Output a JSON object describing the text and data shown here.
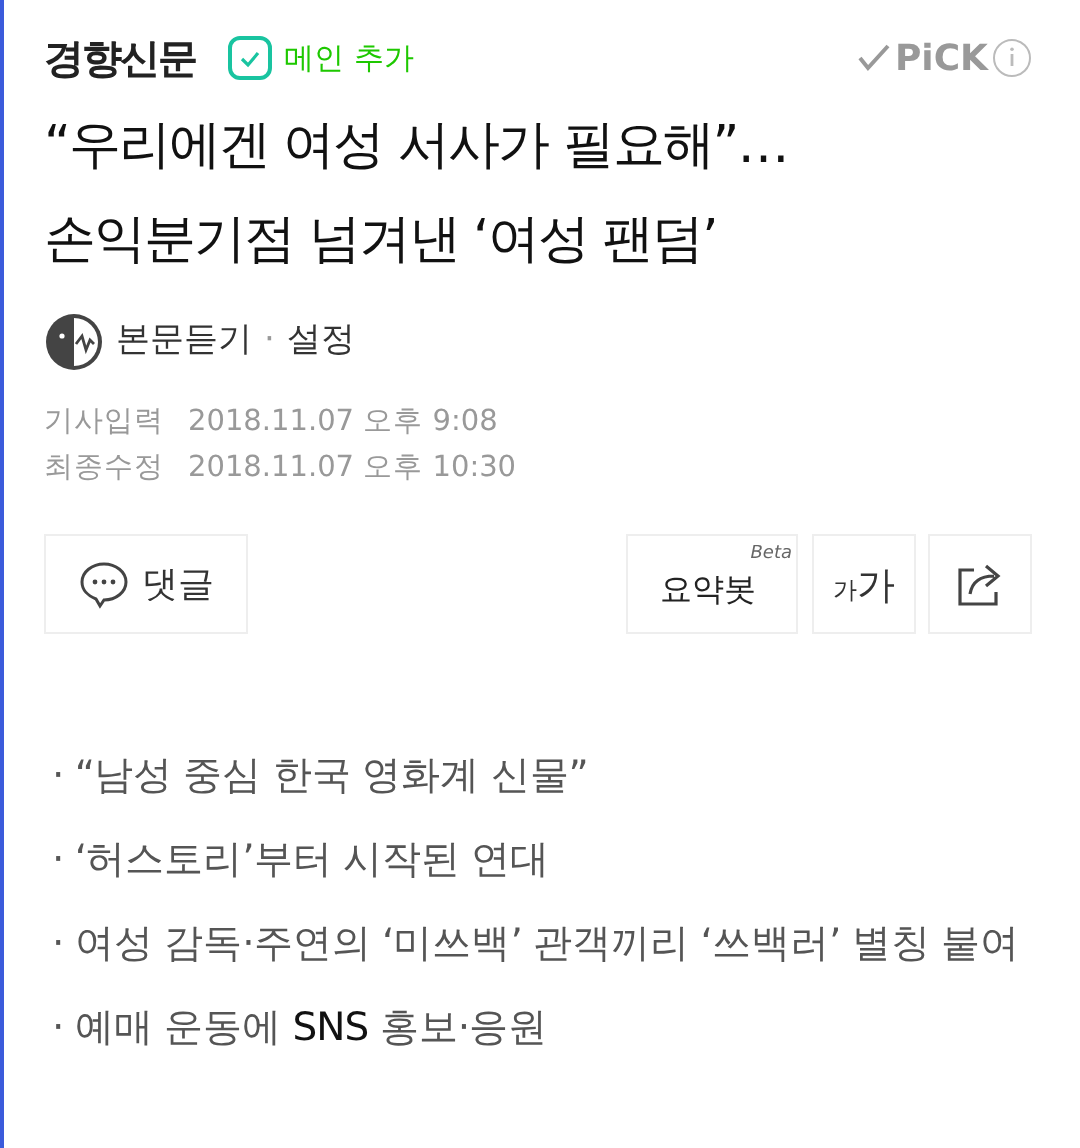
{
  "header": {
    "press": "경향신문",
    "follow_label": "메인 추가",
    "pick_label": "PiCK"
  },
  "headline": [
    "“우리에겐 여성 서사가 필요해”…",
    "손익분기점 넘겨낸 ‘여성 팬덤’"
  ],
  "listen": {
    "label": "본문듣기",
    "separator": "·",
    "settings": "설정"
  },
  "dates": [
    {
      "label": "기사입력",
      "value": "2018.11.07 오후 9:08"
    },
    {
      "label": "최종수정",
      "value": "2018.11.07 오후 10:30"
    }
  ],
  "toolbar": {
    "comment": "댓글",
    "summary": "요약봇",
    "summary_badge": "Beta",
    "font_small": "가",
    "font_large": "가"
  },
  "summary": [
    "· “남성 중심 한국 영화계 신물”",
    "· ‘허스토리’부터 시작된 연대",
    "· 여성 감독·주연의 ‘미쓰백’ 관객끼리 ‘쓰백러’ 별칭 붙여",
    "· 예매 운동에 **SNS** 홍보·응원"
  ]
}
